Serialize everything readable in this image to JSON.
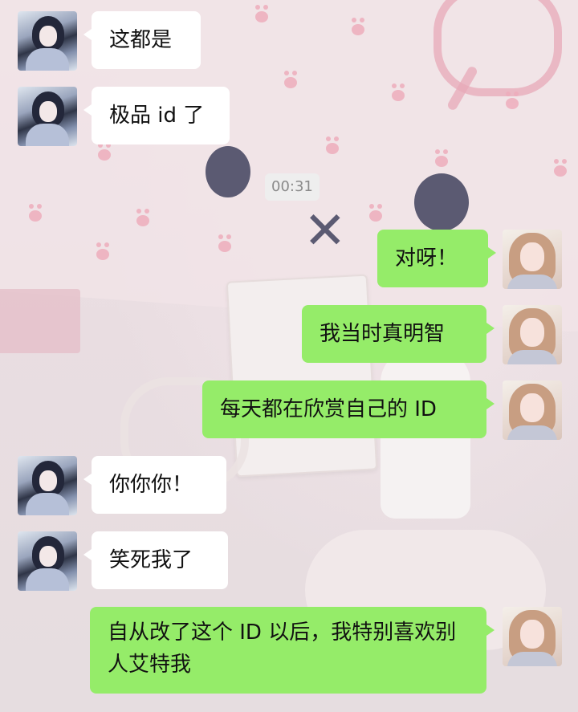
{
  "timestamp": "00:31",
  "messages": [
    {
      "side": "in",
      "text": "这都是"
    },
    {
      "side": "in",
      "text": "极品 id 了"
    },
    {
      "side": "out",
      "text": "对呀！"
    },
    {
      "side": "out",
      "text": "我当时真明智"
    },
    {
      "side": "out",
      "text": "每天都在欣赏自己的 ID"
    },
    {
      "side": "in",
      "text": "你你你！"
    },
    {
      "side": "in",
      "text": "笑死我了"
    },
    {
      "side": "out",
      "text": "自从改了这个 ID 以后，我特别喜欢别人艾特我"
    }
  ],
  "colors": {
    "outgoing_bubble": "#95ec69",
    "incoming_bubble": "#ffffff",
    "timestamp_bg": "#eeeeee"
  }
}
